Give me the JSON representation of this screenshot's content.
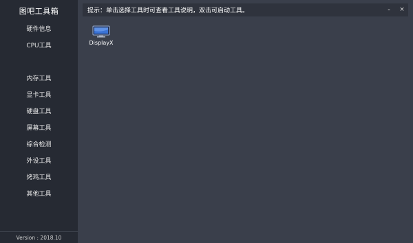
{
  "sidebar": {
    "title": "图吧工具箱",
    "items": [
      {
        "label": "硬件信息"
      },
      {
        "label": "CPU工具"
      },
      {
        "label": "内存工具"
      },
      {
        "label": "显卡工具"
      },
      {
        "label": "硬盘工具"
      },
      {
        "label": "屏幕工具"
      },
      {
        "label": "综合检测"
      },
      {
        "label": "外设工具"
      },
      {
        "label": "烤鸡工具"
      },
      {
        "label": "其他工具"
      }
    ],
    "version": "Version : 2018.10"
  },
  "hint": {
    "text": "提示：单击选择工具时可查看工具说明，双击可启动工具。"
  },
  "window_controls": {
    "minimize": "-",
    "close": "×"
  },
  "tools": [
    {
      "label": "DisplayX",
      "icon": "monitor-icon"
    }
  ],
  "colors": {
    "sidebar_bg": "#262a33",
    "main_bg": "#3a3f4b",
    "hint_bg": "#2f333d",
    "icon_accent": "#3a73d6"
  }
}
